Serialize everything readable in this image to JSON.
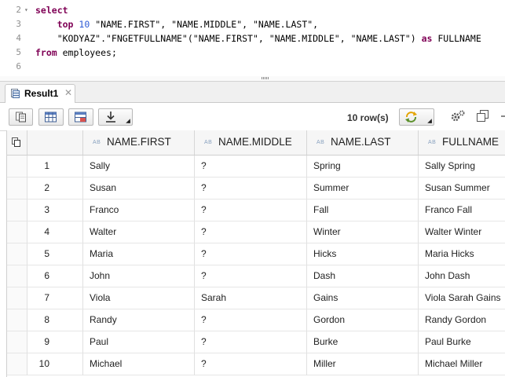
{
  "editor": {
    "lines": [
      {
        "num": "2",
        "fold": "▾",
        "tokens": [
          {
            "t": "select",
            "c": "kw"
          }
        ]
      },
      {
        "num": "3",
        "fold": "",
        "tokens": [
          {
            "t": "    ",
            "c": "pl"
          },
          {
            "t": "top",
            "c": "kw"
          },
          {
            "t": " ",
            "c": "pl"
          },
          {
            "t": "10",
            "c": "num"
          },
          {
            "t": " ",
            "c": "pl"
          },
          {
            "t": "\"NAME.FIRST\", \"NAME.MIDDLE\", \"NAME.LAST\",",
            "c": "pl"
          }
        ]
      },
      {
        "num": "4",
        "fold": "",
        "tokens": [
          {
            "t": "    \"KODYAZ\".\"FNGETFULLNAME\"(\"NAME.FIRST\", \"NAME.MIDDLE\", \"NAME.LAST\") ",
            "c": "pl"
          },
          {
            "t": "as",
            "c": "kw"
          },
          {
            "t": " FULLNAME",
            "c": "pl"
          }
        ]
      },
      {
        "num": "5",
        "fold": "",
        "tokens": [
          {
            "t": "from",
            "c": "kw"
          },
          {
            "t": " employees;",
            "c": "pl"
          }
        ]
      },
      {
        "num": "6",
        "fold": "",
        "tokens": []
      }
    ]
  },
  "tab": {
    "label": "Result1",
    "close": "✕",
    "icon": "result-table-icon"
  },
  "toolbar": {
    "row_count": "10 row(s)",
    "icons": [
      "copy-icon",
      "grid-view-icon",
      "table-export-icon",
      "download-icon",
      "refresh-icon",
      "settings-icon",
      "maximize-icon"
    ]
  },
  "grid": {
    "columns": [
      {
        "key": "first",
        "type": "AB",
        "label": "NAME.FIRST"
      },
      {
        "key": "middle",
        "type": "AB",
        "label": "NAME.MIDDLE"
      },
      {
        "key": "last",
        "type": "AB",
        "label": "NAME.LAST"
      },
      {
        "key": "full",
        "type": "AB",
        "label": "FULLNAME"
      }
    ],
    "rows": [
      {
        "idx": "1",
        "first": "Sally",
        "middle": "?",
        "last": "Spring",
        "full": "Sally Spring"
      },
      {
        "idx": "2",
        "first": "Susan",
        "middle": "?",
        "last": "Summer",
        "full": "Susan Summer"
      },
      {
        "idx": "3",
        "first": "Franco",
        "middle": "?",
        "last": "Fall",
        "full": "Franco Fall"
      },
      {
        "idx": "4",
        "first": "Walter",
        "middle": "?",
        "last": "Winter",
        "full": "Walter Winter"
      },
      {
        "idx": "5",
        "first": "Maria",
        "middle": "?",
        "last": "Hicks",
        "full": "Maria Hicks"
      },
      {
        "idx": "6",
        "first": "John",
        "middle": "?",
        "last": "Dash",
        "full": "John Dash"
      },
      {
        "idx": "7",
        "first": "Viola",
        "middle": "Sarah",
        "last": "Gains",
        "full": "Viola Sarah Gains"
      },
      {
        "idx": "8",
        "first": "Randy",
        "middle": "?",
        "last": "Gordon",
        "full": "Randy Gordon"
      },
      {
        "idx": "9",
        "first": "Paul",
        "middle": "?",
        "last": "Burke",
        "full": "Paul Burke"
      },
      {
        "idx": "10",
        "first": "Michael",
        "middle": "?",
        "last": "Miller",
        "full": "Michael Miller"
      }
    ]
  }
}
